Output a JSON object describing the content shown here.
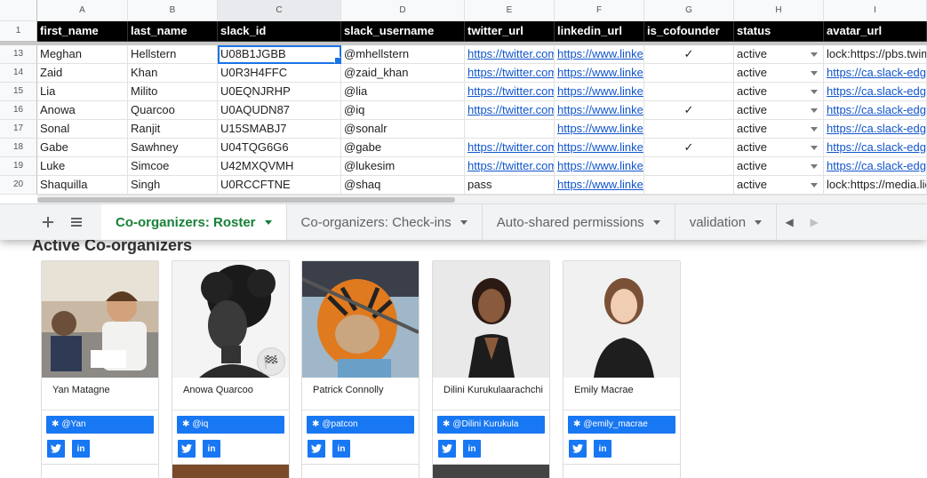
{
  "spreadsheet": {
    "column_letters": [
      "A",
      "B",
      "C",
      "D",
      "E",
      "F",
      "G",
      "H",
      "I"
    ],
    "header_row_number": "1",
    "headers": [
      "first_name",
      "last_name",
      "slack_id",
      "slack_username",
      "twitter_url",
      "linkedin_url",
      "is_cofounder",
      "status",
      "avatar_url"
    ],
    "rows": [
      {
        "n": "13",
        "first": "Meghan",
        "last": "Hellstern",
        "slack_id": "U08B1JGBB",
        "username": "@mhellstern",
        "twitter": "https://twitter.com",
        "linkedin": "https://www.linke",
        "cofounder": "✓",
        "status": "active",
        "avatar": "lock:https://pbs.twimg"
      },
      {
        "n": "14",
        "first": "Zaid",
        "last": "Khan",
        "slack_id": "U0R3H4FFC",
        "username": "@zaid_khan",
        "twitter": "https://twitter.com",
        "linkedin": "https://www.linke",
        "cofounder": "",
        "status": "active",
        "avatar": "https://ca.slack-edge"
      },
      {
        "n": "15",
        "first": "Lia",
        "last": "Milito",
        "slack_id": "U0EQNJRHP",
        "username": "@lia",
        "twitter": "https://twitter.com",
        "linkedin": "https://www.linke",
        "cofounder": "",
        "status": "active",
        "avatar": "https://ca.slack-edge"
      },
      {
        "n": "16",
        "first": "Anowa",
        "last": "Quarcoo",
        "slack_id": "U0AQUDN87",
        "username": "@iq",
        "twitter": "https://twitter.com",
        "linkedin": "https://www.linke",
        "cofounder": "✓",
        "status": "active",
        "avatar": "https://ca.slack-edge"
      },
      {
        "n": "17",
        "first": "Sonal",
        "last": "Ranjit",
        "slack_id": "U15SMABJ7",
        "username": "@sonalr",
        "twitter": "",
        "linkedin": "https://www.linke",
        "cofounder": "",
        "status": "active",
        "avatar": "https://ca.slack-edge"
      },
      {
        "n": "18",
        "first": "Gabe",
        "last": "Sawhney",
        "slack_id": "U04TQG6G6",
        "username": "@gabe",
        "twitter": "https://twitter.com",
        "linkedin": "https://www.linke",
        "cofounder": "✓",
        "status": "active",
        "avatar": "https://ca.slack-edge"
      },
      {
        "n": "19",
        "first": "Luke",
        "last": "Simcoe",
        "slack_id": "U42MXQVMH",
        "username": "@lukesim",
        "twitter": "https://twitter.com",
        "linkedin": "https://www.linke",
        "cofounder": "",
        "status": "active",
        "avatar": "https://ca.slack-edge"
      },
      {
        "n": "20",
        "first": "Shaquilla",
        "last": "Singh",
        "slack_id": "U0RCCFTNE",
        "username": "@shaq",
        "twitter": "pass",
        "linkedin": "https://www.linke",
        "cofounder": "",
        "status": "active",
        "avatar": "lock:https://media.lic"
      }
    ],
    "tabs": [
      {
        "label": "Co-organizers: Roster",
        "active": true
      },
      {
        "label": "Co-organizers: Check-ins",
        "active": false
      },
      {
        "label": "Auto-shared permissions",
        "active": false
      },
      {
        "label": "validation",
        "active": false
      }
    ],
    "add_sheet_icon": "plus-icon",
    "all_sheets_icon": "menu-icon"
  },
  "page": {
    "section_title": "Active Co-organizers",
    "cards": [
      {
        "name": "Yan Matagne",
        "slack": "@Yan",
        "has_flag": false,
        "photo_style": "classroom"
      },
      {
        "name": "Anowa Quarcoo",
        "slack": "@iq",
        "has_flag": true,
        "photo_style": "bw-portrait"
      },
      {
        "name": "Patrick Connolly",
        "slack": "@patcon",
        "has_flag": false,
        "photo_style": "tiger-costume"
      },
      {
        "name": "Dilini Kurukulaarachchi",
        "slack": "@Dilini Kurukula",
        "has_flag": false,
        "photo_style": "studio-portrait"
      },
      {
        "name": "Emily Macrae",
        "slack": "@emily_macrae",
        "has_flag": false,
        "photo_style": "light-portrait"
      }
    ]
  },
  "colors": {
    "header_bg": "#000000",
    "link": "#1155cc",
    "active_tab": "#188038",
    "brand_blue": "#1877f2",
    "selection": "#1a73e8"
  }
}
